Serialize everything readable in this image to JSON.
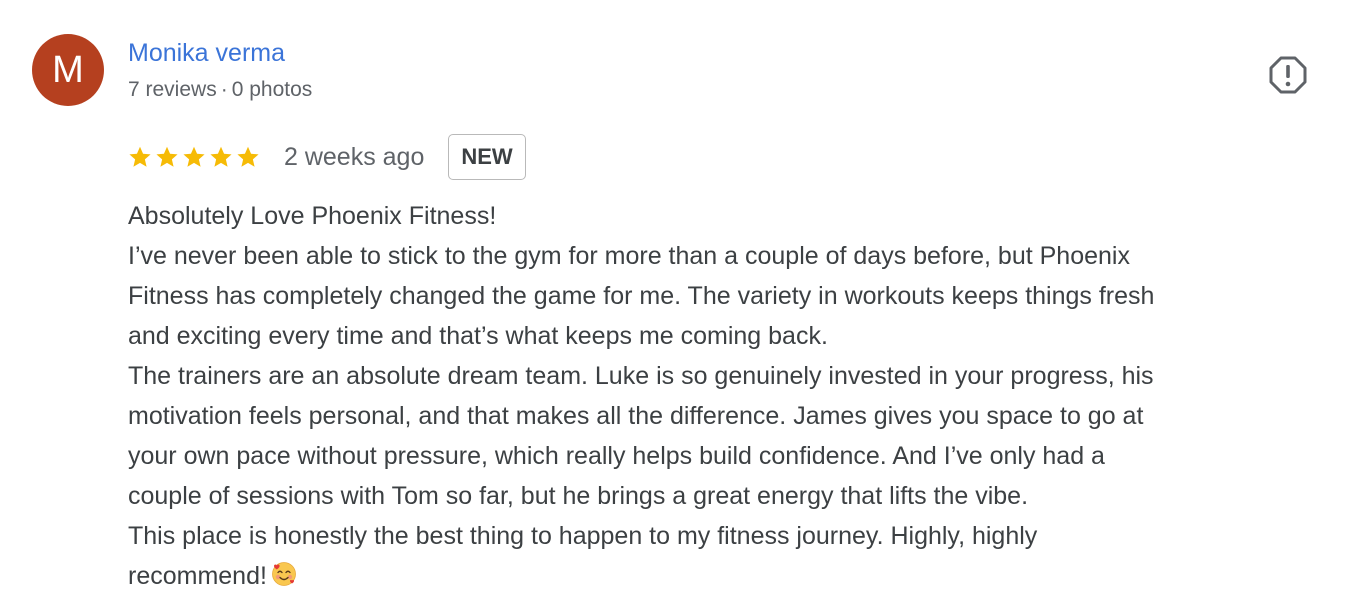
{
  "reviewer": {
    "avatar_initial": "M",
    "avatar_color": "#b5401f",
    "name": "Monika verma",
    "reviews_count": "7 reviews",
    "separator": "·",
    "photos_count": "0 photos"
  },
  "report_button": {
    "icon": "report-flag-icon"
  },
  "rating": {
    "stars": 5,
    "max_stars": 5,
    "star_color": "#f6bb06",
    "date": "2 weeks ago",
    "badge": "NEW"
  },
  "review": {
    "lines": [
      "Absolutely Love Phoenix Fitness!",
      "I’ve never been able to stick to the gym for more than a couple of days before, but Phoenix",
      "Fitness has completely changed the game for me. The variety in workouts keeps things fresh",
      "and exciting every time and that’s what keeps me coming back.",
      "The trainers are an absolute dream team. Luke is so genuinely invested in your progress, his",
      "motivation feels personal, and that makes all the difference. James gives you space to go at",
      "your own pace without pressure, which really helps build confidence. And I’ve only had a",
      "couple of sessions with Tom so far, but he brings a great energy that lifts the vibe.",
      "This place is honestly the best thing to happen to my fitness journey. Highly, highly",
      "recommend!"
    ],
    "trailing_emoji": "smiling-face-with-hearts-icon"
  }
}
